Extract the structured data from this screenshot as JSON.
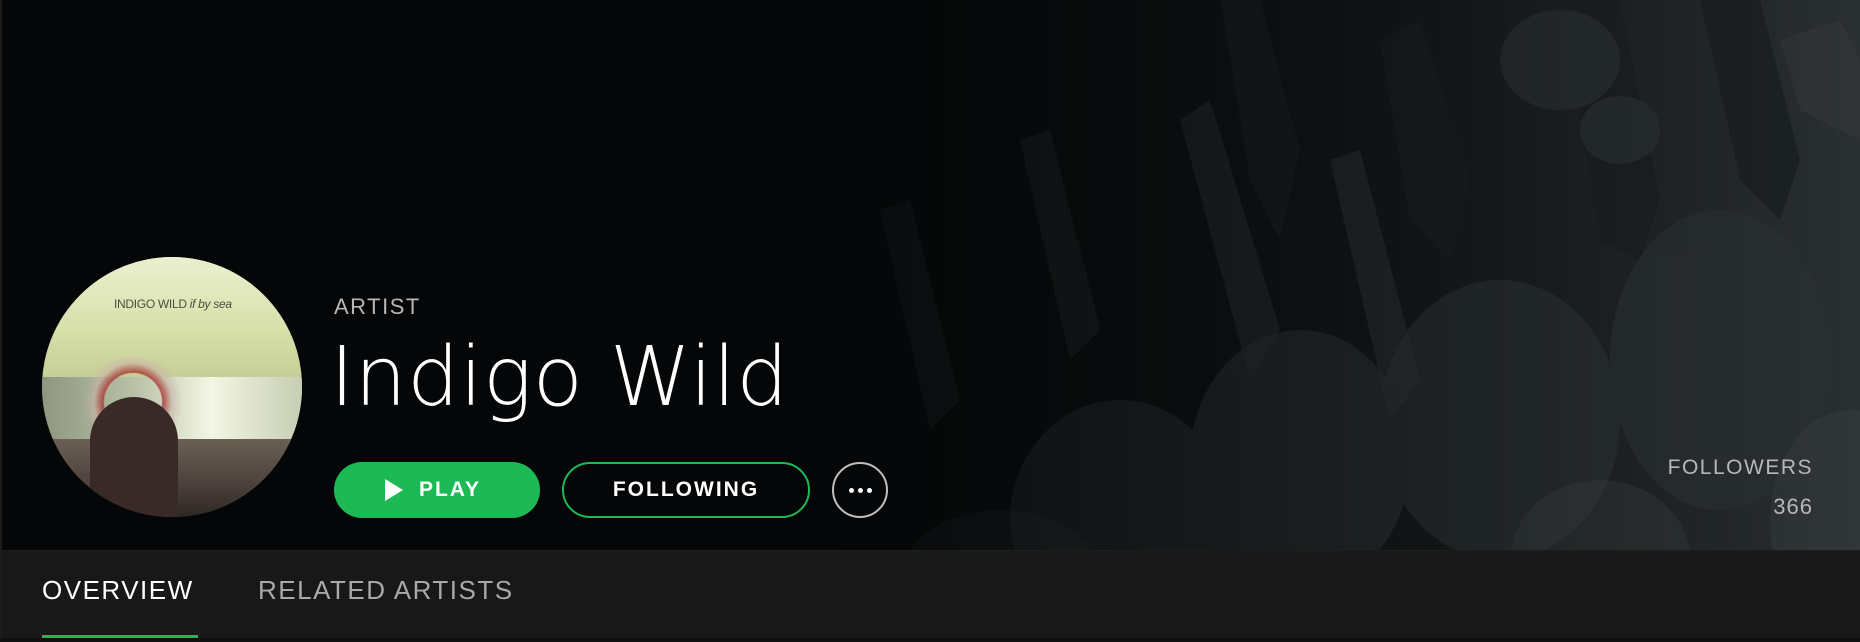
{
  "header": {
    "kind_label": "ARTIST",
    "artist_name": "Indigo Wild",
    "avatar_art_text": "INDIGO WILD",
    "avatar_art_subtext": "if by sea"
  },
  "actions": {
    "play_label": "PLAY",
    "follow_label": "FOLLOWING",
    "more_icon": "ellipsis-icon"
  },
  "stats": {
    "followers_label": "FOLLOWERS",
    "followers_count": "366"
  },
  "tabs": [
    {
      "label": "OVERVIEW",
      "active": true
    },
    {
      "label": "RELATED ARTISTS",
      "active": false
    }
  ],
  "colors": {
    "accent": "#1db954",
    "background": "#050708",
    "tabbar": "#1a1a1a",
    "muted_text": "#b7b7b7"
  }
}
